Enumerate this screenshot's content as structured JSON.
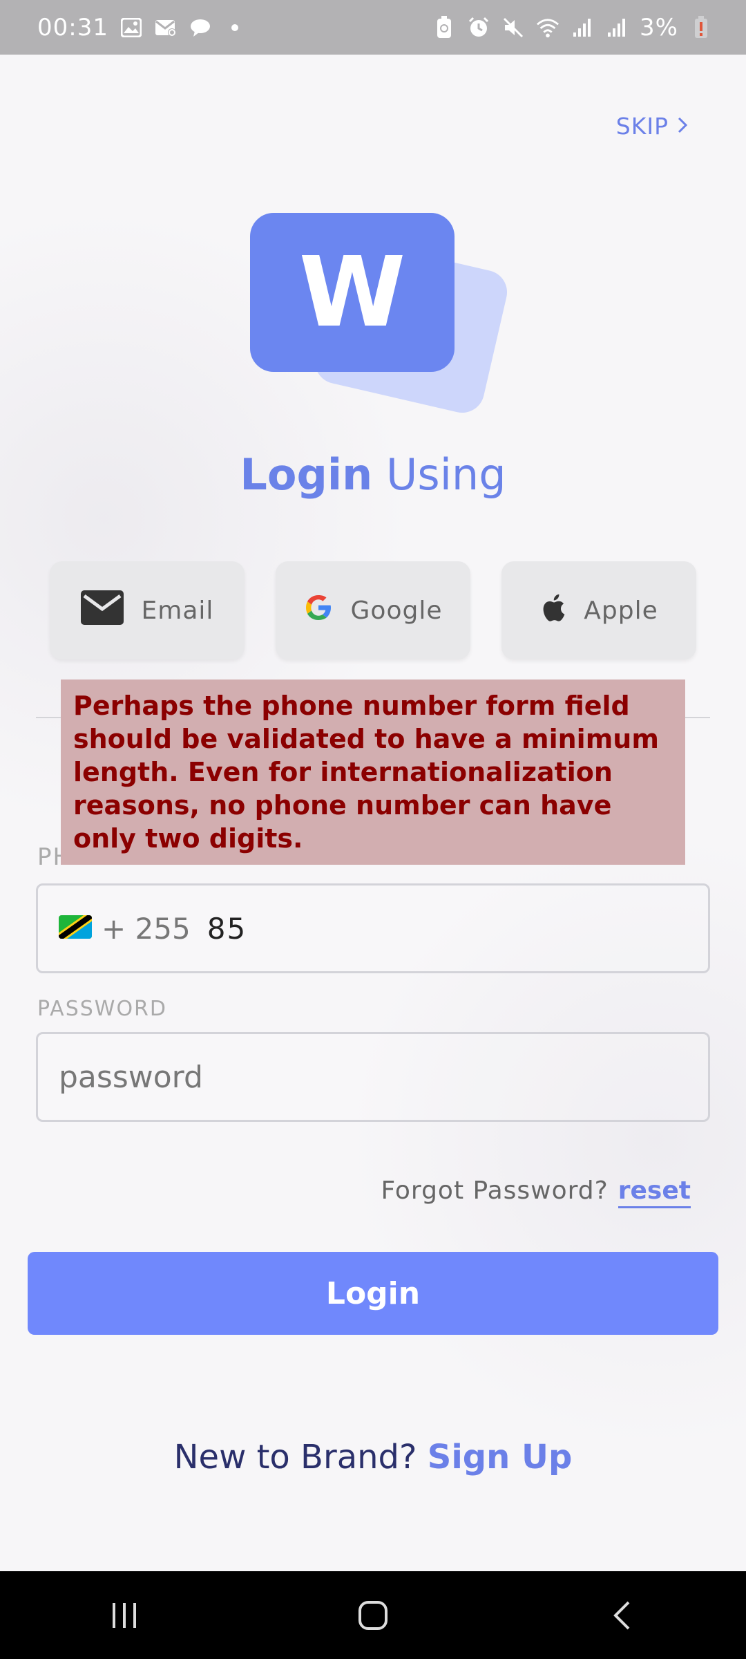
{
  "status_bar": {
    "time": "00:31",
    "battery": "3%"
  },
  "skip_label": "SKIP",
  "logo_letter": "W",
  "heading": {
    "strong": "Login",
    "rest": "Using"
  },
  "social": {
    "email": "Email",
    "google": "Google",
    "apple": "Apple"
  },
  "annotation": "Perhaps the phone number form field should be validated to have a minimum length. Even for internationalization reasons, no phone number can have only two digits.",
  "phone": {
    "label_partial": "PH",
    "prefix": "+ 255",
    "value": "85"
  },
  "password": {
    "label": "PASSWORD",
    "placeholder": "password"
  },
  "forgot": {
    "text": "Forgot Password?",
    "link": "reset"
  },
  "login_label": "Login",
  "signup": {
    "question": "New to Brand?",
    "link": "Sign Up"
  },
  "colors": {
    "accent": "#6b80e8",
    "login_button": "#7088fc",
    "annotation_bg": "#d2aeb0",
    "annotation_text": "#8b0000"
  }
}
